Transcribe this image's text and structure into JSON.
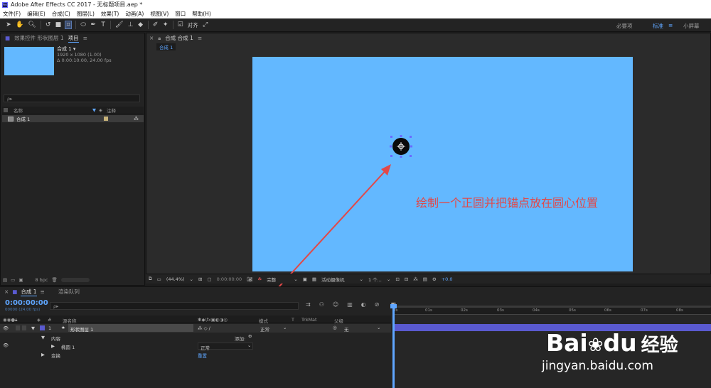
{
  "window": {
    "title": "Adobe After Effects CC 2017 - 无标题项目.aep *",
    "app_icon": "Ae"
  },
  "menu": [
    "文件(F)",
    "编辑(E)",
    "合成(C)",
    "图层(L)",
    "效果(T)",
    "动画(A)",
    "视图(V)",
    "窗口",
    "帮助(H)"
  ],
  "toolbar": {
    "snap_label": "对齐"
  },
  "workspaces": {
    "essential": "必要项",
    "standard": "标准",
    "small_screen": "小屏幕",
    "menu_glyph": "≡"
  },
  "project_panel": {
    "tab_effects": "效果控件 形状图层 1",
    "tab_project": "项目",
    "tab_menu": "≡",
    "comp_name": "合成 1 ▾",
    "comp_res": "1920 x 1080 (1.00)",
    "comp_dur": "Δ 0:00:10:00, 24.00 fps",
    "search_glyph": "ρ▸",
    "col_name": "名称",
    "col_note": "注释",
    "item_name": "合成 1",
    "bpc": "8 bpc"
  },
  "comp_panel": {
    "tab": "合成 合成 1",
    "tab_menu": "≡",
    "breadcrumb": "合成 1"
  },
  "annotation": "绘制一个正圆并把锚点放在圆心位置",
  "viewer_bar": {
    "zoom": "(44.4%)",
    "time": "0:00:00:00",
    "quality": "完整",
    "camera": "活动摄像机",
    "views": "1 个...",
    "exposure": "+0.0"
  },
  "timeline": {
    "tab_comp": "合成 1",
    "tab_render": "渲染队列",
    "tab_menu": "≡",
    "timecode": "0:00:00:00",
    "timecode_sub": "00000 (24.00 fps)",
    "search_glyph": "ρ▸",
    "col_hash": "#",
    "col_source": "源名称",
    "col_mode": "模式",
    "col_t": "T",
    "col_trkmat": "TrkMat",
    "col_parent": "父级",
    "layer_index": "1",
    "layer_name": "形状图层 1",
    "layer_mode": "正常",
    "layer_parent": "无",
    "contents": "内容",
    "add_label": "添加:",
    "ellipse": "椭圆 1",
    "ellipse_mode": "正常",
    "transform": "变换",
    "reset": "重置",
    "ruler_ticks": [
      "0s",
      "01s",
      "02s",
      "03s",
      "04s",
      "05s",
      "06s",
      "07s",
      "08s"
    ]
  },
  "watermark": {
    "brand": "Bai",
    "brand_cn": "经验",
    "brand_tail": "du",
    "url": "jingyan.baidu.com"
  },
  "colors": {
    "comp_bg": "#63b8ff",
    "accent": "#5fa6ff",
    "annotation": "#e24848",
    "layer_bar": "#5a5ad0"
  }
}
